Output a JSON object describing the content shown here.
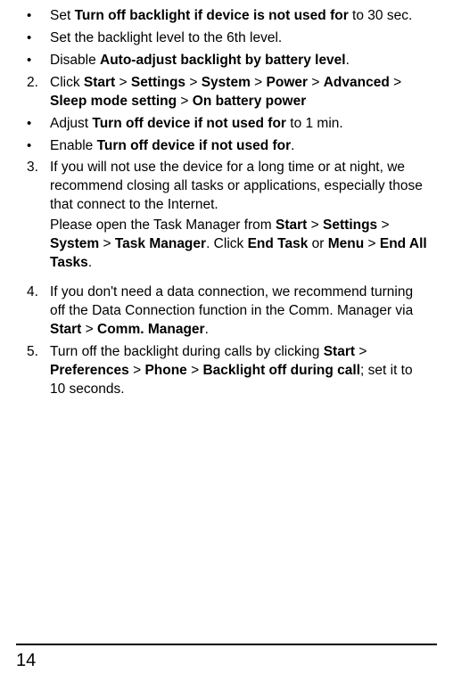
{
  "items": [
    {
      "type": "bullet",
      "runs": [
        {
          "t": "Set "
        },
        {
          "t": "Turn off backlight if device is not used for",
          "b": true
        },
        {
          "t": " to 30 sec."
        }
      ]
    },
    {
      "type": "bullet",
      "runs": [
        {
          "t": "Set the backlight level to the 6th level."
        }
      ]
    },
    {
      "type": "bullet",
      "runs": [
        {
          "t": "Disable "
        },
        {
          "t": "Auto-adjust backlight by battery level",
          "b": true
        },
        {
          "t": "."
        }
      ]
    },
    {
      "type": "num",
      "marker": "2.",
      "runs": [
        {
          "t": "Click "
        },
        {
          "t": "Start",
          "b": true
        },
        {
          "t": " > "
        },
        {
          "t": "Settings",
          "b": true
        },
        {
          "t": " > "
        },
        {
          "t": "System",
          "b": true
        },
        {
          "t": " > "
        },
        {
          "t": "Power",
          "b": true
        },
        {
          "t": " > "
        },
        {
          "t": "Advanced",
          "b": true
        },
        {
          "t": " > "
        },
        {
          "t": "Sleep mode setting",
          "b": true
        },
        {
          "t": " > "
        },
        {
          "t": "On battery power",
          "b": true
        }
      ]
    },
    {
      "type": "bullet",
      "runs": [
        {
          "t": "Adjust "
        },
        {
          "t": "Turn off device if not used for",
          "b": true
        },
        {
          "t": " to 1 min."
        }
      ]
    },
    {
      "type": "bullet",
      "runs": [
        {
          "t": "Enable "
        },
        {
          "t": "Turn off device if not used for",
          "b": true
        },
        {
          "t": "."
        }
      ]
    },
    {
      "type": "num",
      "marker": "3.",
      "paras": [
        [
          {
            "t": "If you will not use the device for a long time or at night, we recommend closing all tasks or applications, especially those that connect to the Internet."
          }
        ],
        [
          {
            "t": "Please open the Task Manager from "
          },
          {
            "t": "Start",
            "b": true
          },
          {
            "t": " > "
          },
          {
            "t": "Settings",
            "b": true
          },
          {
            "t": " > "
          },
          {
            "t": "System",
            "b": true
          },
          {
            "t": " > "
          },
          {
            "t": "Task Manager",
            "b": true
          },
          {
            "t": ". Click "
          },
          {
            "t": "End Task",
            "b": true
          },
          {
            "t": " or "
          },
          {
            "t": "Menu",
            "b": true
          },
          {
            "t": " > "
          },
          {
            "t": "End All Tasks",
            "b": true
          },
          {
            "t": "."
          }
        ]
      ]
    },
    {
      "type": "spacer"
    },
    {
      "type": "num",
      "marker": "4.",
      "runs": [
        {
          "t": "If you don't need a data connection, we recommend turning off the Data Connection function in the Comm. Manager via "
        },
        {
          "t": "Start",
          "b": true
        },
        {
          "t": " > "
        },
        {
          "t": "Comm. Manager",
          "b": true
        },
        {
          "t": "."
        }
      ]
    },
    {
      "type": "num",
      "marker": "5.",
      "runs": [
        {
          "t": "Turn off the backlight during calls by clicking "
        },
        {
          "t": "Start",
          "b": true
        },
        {
          "t": " > "
        },
        {
          "t": "Preferences",
          "b": true
        },
        {
          "t": " > "
        },
        {
          "t": "Phone",
          "b": true
        },
        {
          "t": " > "
        },
        {
          "t": "Backlight off during call",
          "b": true
        },
        {
          "t": "; set it to 10 seconds."
        }
      ]
    }
  ],
  "pageNumber": "14"
}
